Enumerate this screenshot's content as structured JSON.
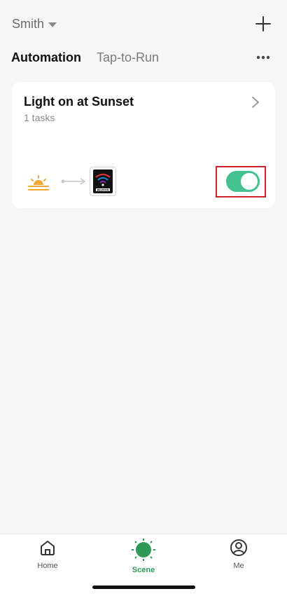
{
  "header": {
    "home_name": "Smith"
  },
  "tabs": [
    {
      "label": "Automation",
      "active": true
    },
    {
      "label": "Tap-to-Run",
      "active": false
    }
  ],
  "card": {
    "title": "Light on at Sunset",
    "subtitle": "1 tasks",
    "enabled": true,
    "condition_icon": "sunset-icon",
    "action_icon": "wifi-device-icon",
    "device_label": "BELMON"
  },
  "bottom_nav": [
    {
      "label": "Home",
      "icon": "home-icon",
      "active": false
    },
    {
      "label": "Scene",
      "icon": "sun-icon",
      "active": true
    },
    {
      "label": "Me",
      "icon": "profile-icon",
      "active": false
    }
  ],
  "colors": {
    "accent_green": "#43c28f",
    "nav_active_green": "#2e9a57",
    "sunset_orange": "#f3a733",
    "highlight_red": "#d0202a",
    "background": "#f6f6f6"
  }
}
